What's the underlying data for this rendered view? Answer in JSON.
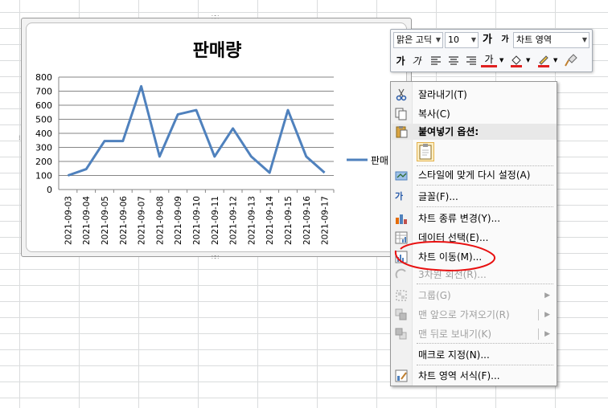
{
  "chart": {
    "title": "판매량",
    "legend_label": "판매",
    "line_color": "#4f81bd"
  },
  "chart_data": {
    "type": "line",
    "title": "판매량",
    "x": [
      "2021-09-03",
      "2021-09-04",
      "2021-09-05",
      "2021-09-06",
      "2021-09-07",
      "2021-09-08",
      "2021-09-09",
      "2021-09-10",
      "2021-09-11",
      "2021-09-12",
      "2021-09-13",
      "2021-09-14",
      "2021-09-15",
      "2021-09-16",
      "2021-09-17"
    ],
    "series": [
      {
        "name": "판매",
        "values": [
          100,
          145,
          345,
          345,
          735,
          235,
          535,
          565,
          235,
          435,
          235,
          120,
          565,
          235,
          120
        ]
      }
    ],
    "y_ticks": [
      "0",
      "100",
      "200",
      "300",
      "400",
      "500",
      "600",
      "700",
      "800"
    ],
    "ylim": [
      0,
      800
    ],
    "grid": true,
    "legend_position": "right"
  },
  "toolbar": {
    "font_name": "맑은 고딕",
    "font_size": "10",
    "grow_font": "가",
    "shrink_font": "가",
    "chart_element": "차트 영역",
    "bold": "가",
    "italic": "가",
    "font_color": "가"
  },
  "menu": {
    "cut": "잘라내기(T)",
    "copy": "복사(C)",
    "paste_options": "붙여넣기 옵션:",
    "reset_style": "스타일에 맞게 다시 설정(A)",
    "font": "글꼴(F)...",
    "change_chart_type": "차트 종류 변경(Y)...",
    "select_data": "데이터 선택(E)...",
    "move_chart": "차트 이동(M)...",
    "rotation_3d": "3차원 회전(R)...",
    "group": "그룹(G)",
    "bring_to_front": "맨 앞으로 가져오기(R)",
    "send_to_back": "맨 뒤로 보내기(K)",
    "assign_macro": "매크로 지정(N)...",
    "format_chart_area": "차트 영역 서식(F)..."
  }
}
